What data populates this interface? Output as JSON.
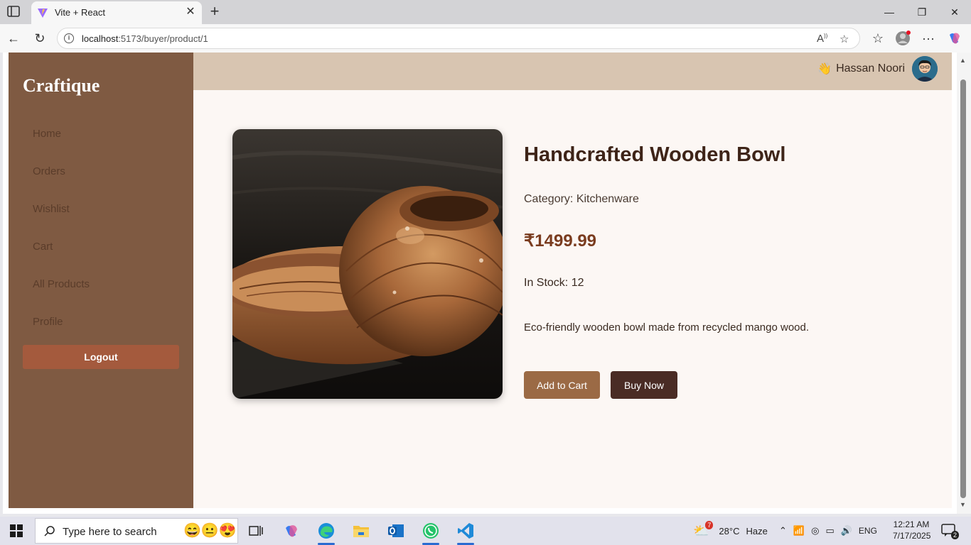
{
  "browser": {
    "tab_title": "Vite + React",
    "url_host": "localhost",
    "url_path": ":5173/buyer/product/1"
  },
  "app": {
    "brand": "Craftique",
    "nav": [
      {
        "label": "Home"
      },
      {
        "label": "Orders"
      },
      {
        "label": "Wishlist"
      },
      {
        "label": "Cart"
      },
      {
        "label": "All Products"
      },
      {
        "label": "Profile"
      }
    ],
    "logout_label": "Logout",
    "user_emoji": "👋",
    "user_name": "Hassan Noori"
  },
  "product": {
    "title": "Handcrafted Wooden Bowl",
    "category": "Category: Kitchenware",
    "price": "₹1499.99",
    "stock": "In Stock: 12",
    "description": "Eco-friendly wooden bowl made from recycled mango wood.",
    "add_to_cart_label": "Add to Cart",
    "buy_now_label": "Buy Now"
  },
  "taskbar": {
    "search_placeholder": "Type here to search",
    "search_emoji": "😄😐😍",
    "weather_temp": "28°C",
    "weather_desc": "Haze",
    "weather_badge": "7",
    "language": "ENG",
    "time": "12:21 AM",
    "date": "7/17/2025",
    "notification_count": "2"
  },
  "colors": {
    "sidebar": "#7f5a42",
    "topbar": "#d8c5b1",
    "content_bg": "#fcf7f4",
    "logout": "#a45a3d",
    "add_to_cart": "#9b6a45",
    "buy_now": "#4a2c25",
    "price": "#7a3c1f"
  }
}
